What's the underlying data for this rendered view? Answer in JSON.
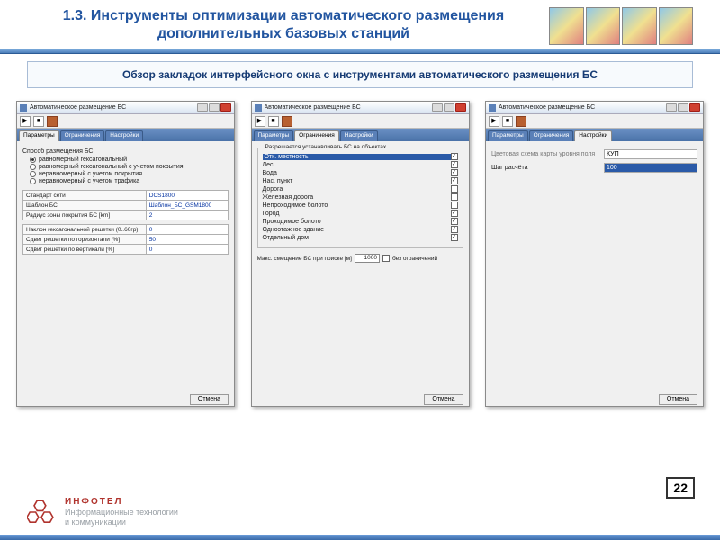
{
  "title": "1.3. Инструменты оптимизации автоматического размещения дополнительных базовых станций",
  "subtitle": "Обзор закладок интерфейсного окна с инструментами автоматического размещения БС",
  "page_number": "22",
  "company": {
    "name": "ИНФОТЕЛ",
    "tagline1": "Информационные технологии",
    "tagline2": "и коммуникации"
  },
  "window_title": "Автоматическое размещение БС",
  "cancel_button": "Отмена",
  "tabs": {
    "t1": "Параметры",
    "t2": "Ограничения",
    "t3": "Настройки"
  },
  "panel1": {
    "group_label": "Способ размещения БС",
    "r1": "равномерный гексагональный",
    "r2": "равномерный гексагональный с учетом покрытия",
    "r3": "неравномерный с учетом покрытия",
    "r4": "неравномерный с учетом трафика",
    "rows": [
      {
        "k": "Стандарт сети",
        "v": "DCS1800"
      },
      {
        "k": "Шаблон БС",
        "v": "Шаблон_БС_GSM1800"
      },
      {
        "k": "Радиус зоны покрытия БС [km]",
        "v": "2"
      }
    ],
    "rows2": [
      {
        "k": "Наклон гексагональной решетки (0..60гр)",
        "v": "0"
      },
      {
        "k": "Сдвиг решетки по горизонтали [%]",
        "v": "50"
      },
      {
        "k": "Сдвиг решетки по вертикали [%]",
        "v": "0"
      }
    ]
  },
  "panel2": {
    "legend": "Разрешается устанавливать БС на объектах",
    "items": [
      {
        "label": "Отк. местность",
        "checked": true,
        "highlight": true
      },
      {
        "label": "Лес",
        "checked": true
      },
      {
        "label": "Вода",
        "checked": true
      },
      {
        "label": "Нас. пункт",
        "checked": true
      },
      {
        "label": "Дорога",
        "checked": false
      },
      {
        "label": "Железная дорога",
        "checked": false
      },
      {
        "label": "Непроходимое болото",
        "checked": false
      },
      {
        "label": "Город",
        "checked": true
      },
      {
        "label": "Проходимое болото",
        "checked": true
      },
      {
        "label": "Одноэтажное здание",
        "checked": true
      },
      {
        "label": "Отдельный дом",
        "checked": true
      }
    ],
    "max_offset_label": "Макс. смещение БС при поиске [м]",
    "max_offset_value": "1000",
    "unlimited_label": "без ограничений"
  },
  "panel3": {
    "row1_label": "Цветовая схема карты уровня поля",
    "row1_value": "КУП",
    "row2_label": "Шаг расчёта",
    "row2_value": "100"
  }
}
